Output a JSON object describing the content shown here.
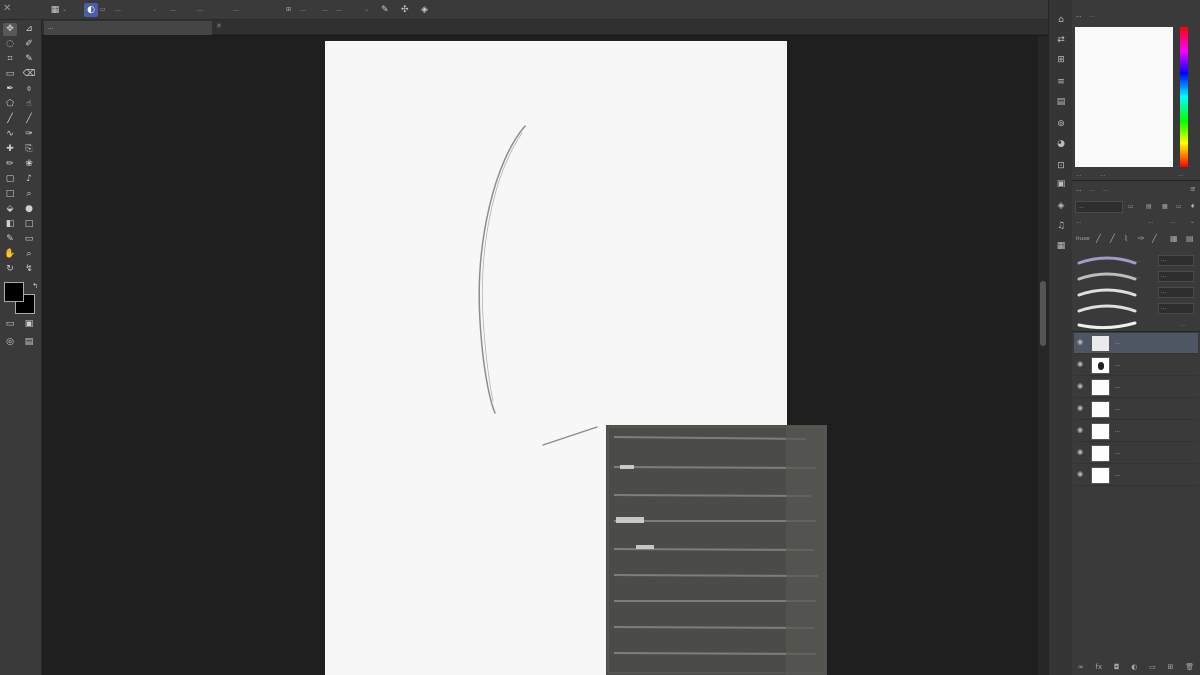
{
  "options_bar": {
    "preset_label": "…",
    "brush_size": "…",
    "mode": "…",
    "opacity_label": "…",
    "flow_label": "…",
    "smoothing_label": "…",
    "smoothing_value": "…"
  },
  "document": {
    "tab_title": "…"
  },
  "tools": {
    "left_column": [
      "move-tool",
      "lasso-tool",
      "quick-select-tool",
      "crop-tool",
      "eyedropper-tool",
      "spot-heal-tool",
      "brush-tool",
      "clone-tool",
      "history-brush-tool",
      "eraser-tool",
      "gradient-tool",
      "blur-tool",
      "dodge-tool",
      "pen-tool",
      "type-tool",
      "path-select-tool",
      "shape-tool",
      "hand-tool",
      "zoom-tool",
      "rotate-tool"
    ],
    "foreground_color": "#000000",
    "background_color": "#000000"
  },
  "color_panel": {
    "tabs": [
      "…",
      "…"
    ],
    "footer_label": "…",
    "footer_value": "…",
    "footer_right": "…"
  },
  "brushes_panel": {
    "tabs": [
      "…",
      "…",
      "…"
    ],
    "search_placeholder": "…",
    "preset_label": "…",
    "preset_mode_1": "…",
    "preset_mode_2": "…",
    "rows": [
      {
        "name": "…",
        "size": "…",
        "mode": "…",
        "color": "#a89ac8"
      },
      {
        "name": "…",
        "size": "…",
        "mode": "…",
        "color": "#bdbdbd"
      },
      {
        "name": "…",
        "size": "…",
        "mode": "…",
        "color": "#e0e0e0"
      },
      {
        "name": "…",
        "size": "…",
        "mode": "…",
        "color": "#e0e0e0"
      },
      {
        "name": "…",
        "size": "",
        "mode": "",
        "color": "#f0f0f0"
      }
    ]
  },
  "layers_panel": {
    "layers": [
      {
        "name": "…",
        "visible": true,
        "active": true
      },
      {
        "name": "…",
        "visible": true,
        "active": false
      },
      {
        "name": "…",
        "visible": true,
        "active": false
      },
      {
        "name": "…",
        "visible": true,
        "active": false
      },
      {
        "name": "…",
        "visible": true,
        "active": false
      },
      {
        "name": "…",
        "visible": true,
        "active": false
      },
      {
        "name": "…",
        "visible": true,
        "active": false
      }
    ]
  }
}
